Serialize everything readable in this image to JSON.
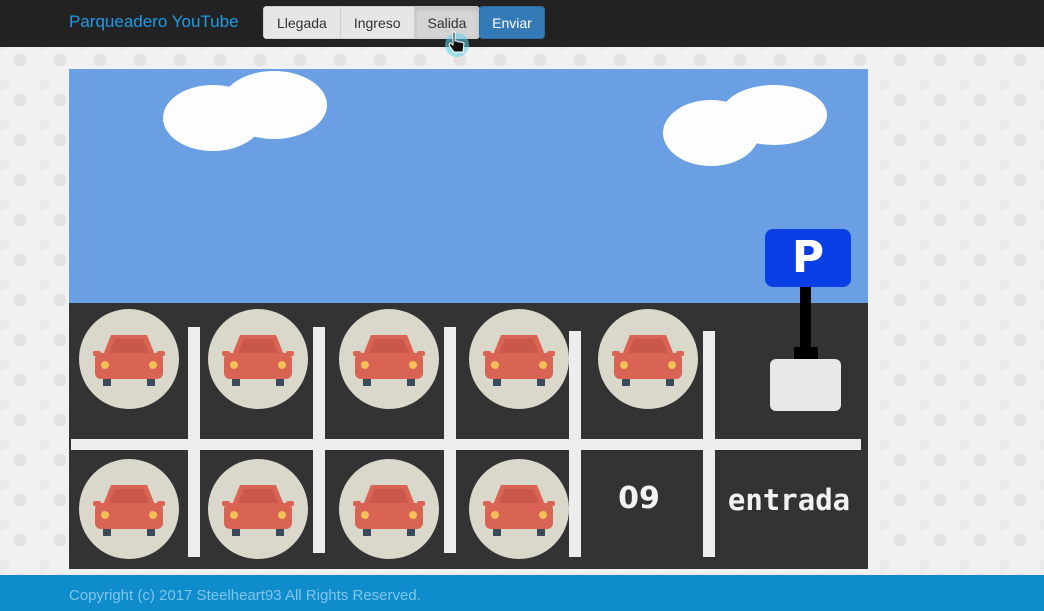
{
  "navbar": {
    "brand": "Parqueadero YouTube",
    "buttons": [
      {
        "label": "Llegada",
        "active": false
      },
      {
        "label": "Ingreso",
        "active": false
      },
      {
        "label": "Salida",
        "active": true
      }
    ],
    "send_label": "Enviar"
  },
  "scene": {
    "sign_letter": "P",
    "slot_number": "09",
    "entrance_label": "entrada",
    "occupied_slots": 9
  },
  "footer": {
    "copyright": "Copyright (c) 2017 Steelheart93 All Rights Reserved."
  },
  "colors": {
    "navbar": "#222222",
    "brand": "#1e9be6",
    "sky": "#6a9fe3",
    "road": "#333333",
    "car": "#d96453",
    "sign": "#0a3fe6",
    "footer": "#0f8ccc"
  },
  "icons": [
    "car-icon",
    "pointer-cursor-icon",
    "parking-sign-icon",
    "cloud-icon"
  ]
}
